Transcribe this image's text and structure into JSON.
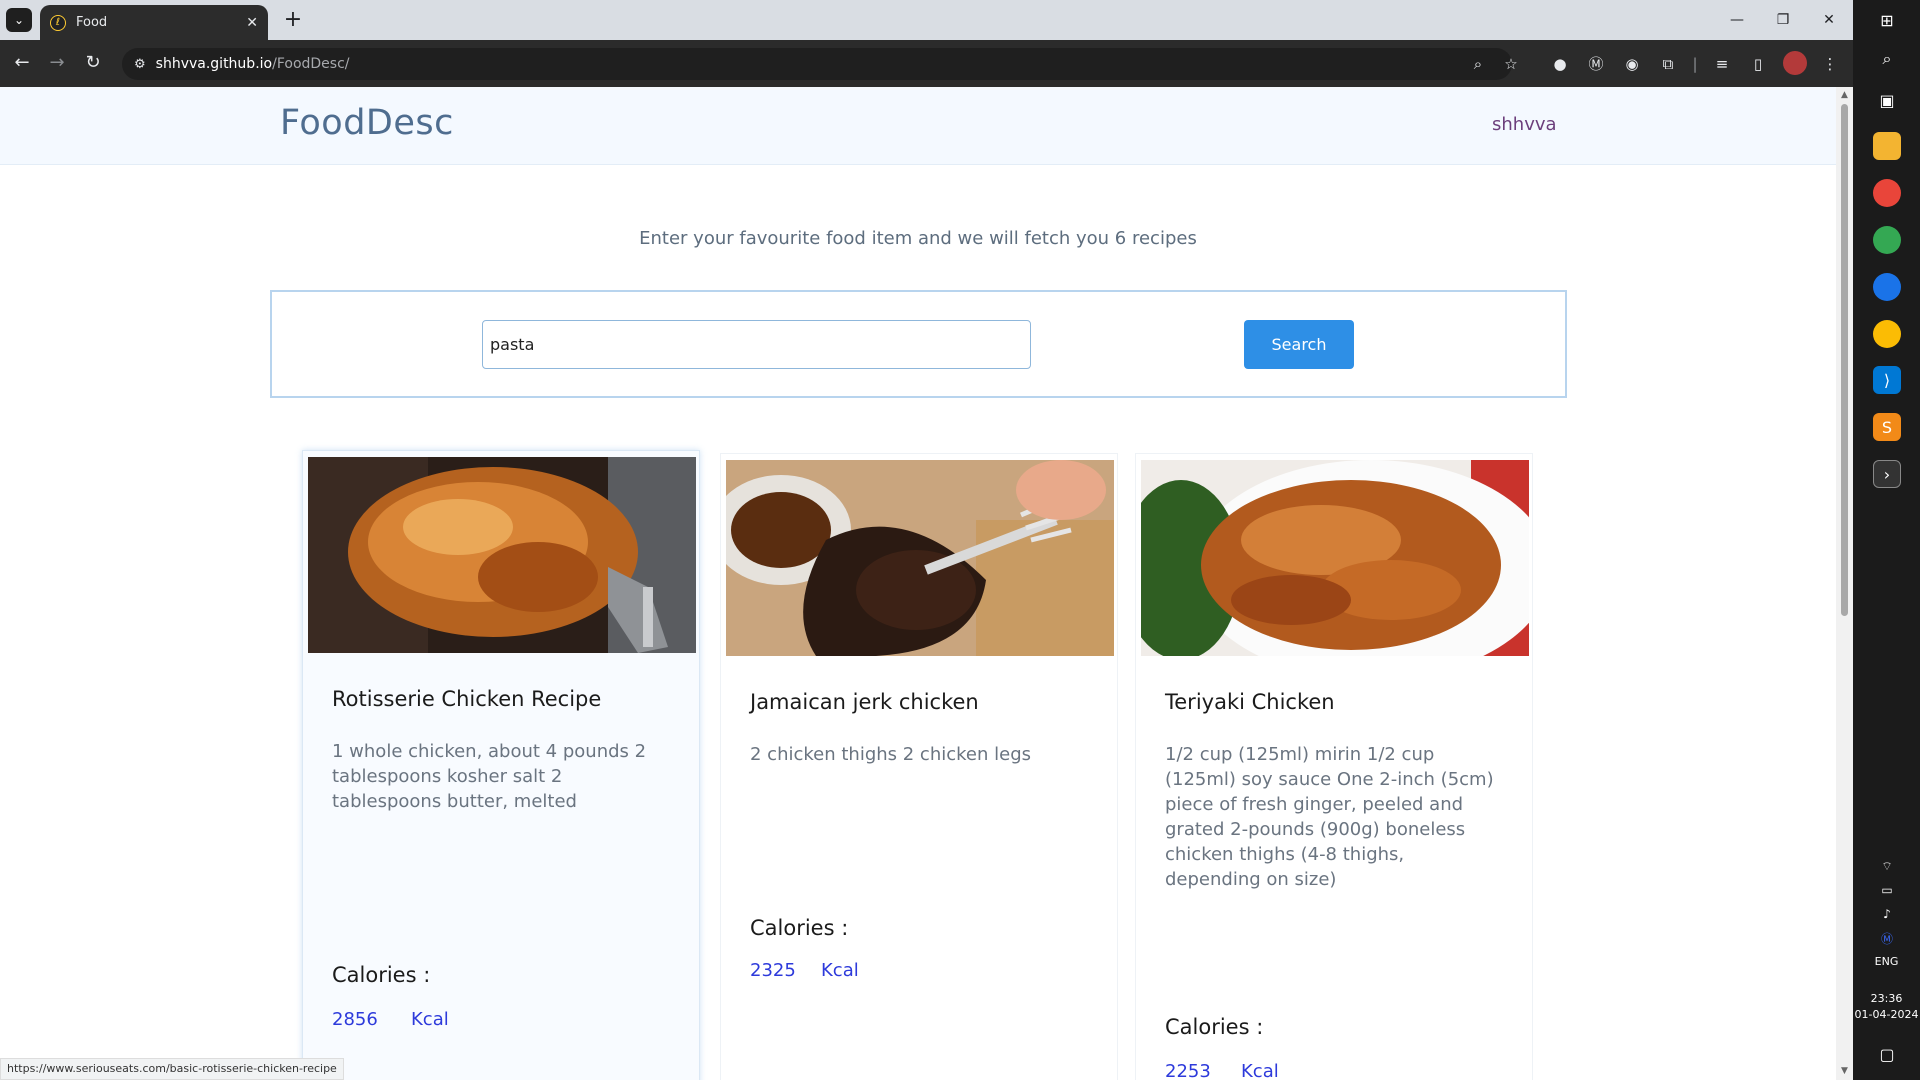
{
  "browser": {
    "tab_title": "Food",
    "tab_close": "✕",
    "new_tab": "+",
    "url_host": "shhvva.github.io",
    "url_path": "/FoodDesc/",
    "status_url": "https://www.seriouseats.com/basic-rotisserie-chicken-recipe"
  },
  "site": {
    "brand": "FoodDesc",
    "user": "shhvva",
    "intro": "Enter your favourite food item and we will fetch you 6 recipes",
    "search_value": "pasta",
    "search_button": "Search"
  },
  "cards": [
    {
      "title": "Rotisserie Chicken Recipe",
      "ingredients": "1 whole chicken, about 4 pounds 2 tablespoons kosher salt 2 tablespoons butter, melted",
      "calories_label": "Calories :",
      "calories": "2856",
      "unit": "Kcal"
    },
    {
      "title": "Jamaican jerk chicken",
      "ingredients": "2 chicken thighs 2 chicken legs",
      "calories_label": "Calories :",
      "calories": "2325",
      "unit": "Kcal"
    },
    {
      "title": "Teriyaki Chicken",
      "ingredients": "1/2 cup (125ml) mirin 1/2 cup (125ml) soy sauce One 2-inch (5cm) piece of fresh ginger, peeled and grated 2-pounds (900g) boneless chicken thighs (4-8 thighs, depending on size)",
      "calories_label": "Calories :",
      "calories": "2253",
      "unit": "Kcal"
    }
  ],
  "taskbar": {
    "language": "ENG",
    "time": "23:36",
    "date": "01-04-2024"
  },
  "colors": {
    "accent": "#2e8fe6",
    "brand": "#4f6d8f",
    "calories": "#2d3adb"
  }
}
